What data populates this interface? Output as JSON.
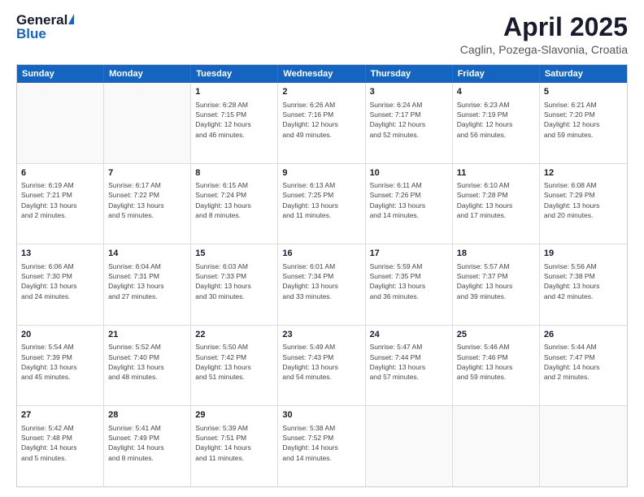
{
  "header": {
    "logo_general": "General",
    "logo_blue": "Blue",
    "title": "April 2025",
    "subtitle": "Caglin, Pozega-Slavonia, Croatia"
  },
  "calendar": {
    "weekdays": [
      "Sunday",
      "Monday",
      "Tuesday",
      "Wednesday",
      "Thursday",
      "Friday",
      "Saturday"
    ],
    "rows": [
      [
        {
          "day": "",
          "info": ""
        },
        {
          "day": "",
          "info": ""
        },
        {
          "day": "1",
          "info": "Sunrise: 6:28 AM\nSunset: 7:15 PM\nDaylight: 12 hours\nand 46 minutes."
        },
        {
          "day": "2",
          "info": "Sunrise: 6:26 AM\nSunset: 7:16 PM\nDaylight: 12 hours\nand 49 minutes."
        },
        {
          "day": "3",
          "info": "Sunrise: 6:24 AM\nSunset: 7:17 PM\nDaylight: 12 hours\nand 52 minutes."
        },
        {
          "day": "4",
          "info": "Sunrise: 6:23 AM\nSunset: 7:19 PM\nDaylight: 12 hours\nand 56 minutes."
        },
        {
          "day": "5",
          "info": "Sunrise: 6:21 AM\nSunset: 7:20 PM\nDaylight: 12 hours\nand 59 minutes."
        }
      ],
      [
        {
          "day": "6",
          "info": "Sunrise: 6:19 AM\nSunset: 7:21 PM\nDaylight: 13 hours\nand 2 minutes."
        },
        {
          "day": "7",
          "info": "Sunrise: 6:17 AM\nSunset: 7:22 PM\nDaylight: 13 hours\nand 5 minutes."
        },
        {
          "day": "8",
          "info": "Sunrise: 6:15 AM\nSunset: 7:24 PM\nDaylight: 13 hours\nand 8 minutes."
        },
        {
          "day": "9",
          "info": "Sunrise: 6:13 AM\nSunset: 7:25 PM\nDaylight: 13 hours\nand 11 minutes."
        },
        {
          "day": "10",
          "info": "Sunrise: 6:11 AM\nSunset: 7:26 PM\nDaylight: 13 hours\nand 14 minutes."
        },
        {
          "day": "11",
          "info": "Sunrise: 6:10 AM\nSunset: 7:28 PM\nDaylight: 13 hours\nand 17 minutes."
        },
        {
          "day": "12",
          "info": "Sunrise: 6:08 AM\nSunset: 7:29 PM\nDaylight: 13 hours\nand 20 minutes."
        }
      ],
      [
        {
          "day": "13",
          "info": "Sunrise: 6:06 AM\nSunset: 7:30 PM\nDaylight: 13 hours\nand 24 minutes."
        },
        {
          "day": "14",
          "info": "Sunrise: 6:04 AM\nSunset: 7:31 PM\nDaylight: 13 hours\nand 27 minutes."
        },
        {
          "day": "15",
          "info": "Sunrise: 6:03 AM\nSunset: 7:33 PM\nDaylight: 13 hours\nand 30 minutes."
        },
        {
          "day": "16",
          "info": "Sunrise: 6:01 AM\nSunset: 7:34 PM\nDaylight: 13 hours\nand 33 minutes."
        },
        {
          "day": "17",
          "info": "Sunrise: 5:59 AM\nSunset: 7:35 PM\nDaylight: 13 hours\nand 36 minutes."
        },
        {
          "day": "18",
          "info": "Sunrise: 5:57 AM\nSunset: 7:37 PM\nDaylight: 13 hours\nand 39 minutes."
        },
        {
          "day": "19",
          "info": "Sunrise: 5:56 AM\nSunset: 7:38 PM\nDaylight: 13 hours\nand 42 minutes."
        }
      ],
      [
        {
          "day": "20",
          "info": "Sunrise: 5:54 AM\nSunset: 7:39 PM\nDaylight: 13 hours\nand 45 minutes."
        },
        {
          "day": "21",
          "info": "Sunrise: 5:52 AM\nSunset: 7:40 PM\nDaylight: 13 hours\nand 48 minutes."
        },
        {
          "day": "22",
          "info": "Sunrise: 5:50 AM\nSunset: 7:42 PM\nDaylight: 13 hours\nand 51 minutes."
        },
        {
          "day": "23",
          "info": "Sunrise: 5:49 AM\nSunset: 7:43 PM\nDaylight: 13 hours\nand 54 minutes."
        },
        {
          "day": "24",
          "info": "Sunrise: 5:47 AM\nSunset: 7:44 PM\nDaylight: 13 hours\nand 57 minutes."
        },
        {
          "day": "25",
          "info": "Sunrise: 5:46 AM\nSunset: 7:46 PM\nDaylight: 13 hours\nand 59 minutes."
        },
        {
          "day": "26",
          "info": "Sunrise: 5:44 AM\nSunset: 7:47 PM\nDaylight: 14 hours\nand 2 minutes."
        }
      ],
      [
        {
          "day": "27",
          "info": "Sunrise: 5:42 AM\nSunset: 7:48 PM\nDaylight: 14 hours\nand 5 minutes."
        },
        {
          "day": "28",
          "info": "Sunrise: 5:41 AM\nSunset: 7:49 PM\nDaylight: 14 hours\nand 8 minutes."
        },
        {
          "day": "29",
          "info": "Sunrise: 5:39 AM\nSunset: 7:51 PM\nDaylight: 14 hours\nand 11 minutes."
        },
        {
          "day": "30",
          "info": "Sunrise: 5:38 AM\nSunset: 7:52 PM\nDaylight: 14 hours\nand 14 minutes."
        },
        {
          "day": "",
          "info": ""
        },
        {
          "day": "",
          "info": ""
        },
        {
          "day": "",
          "info": ""
        }
      ]
    ]
  }
}
